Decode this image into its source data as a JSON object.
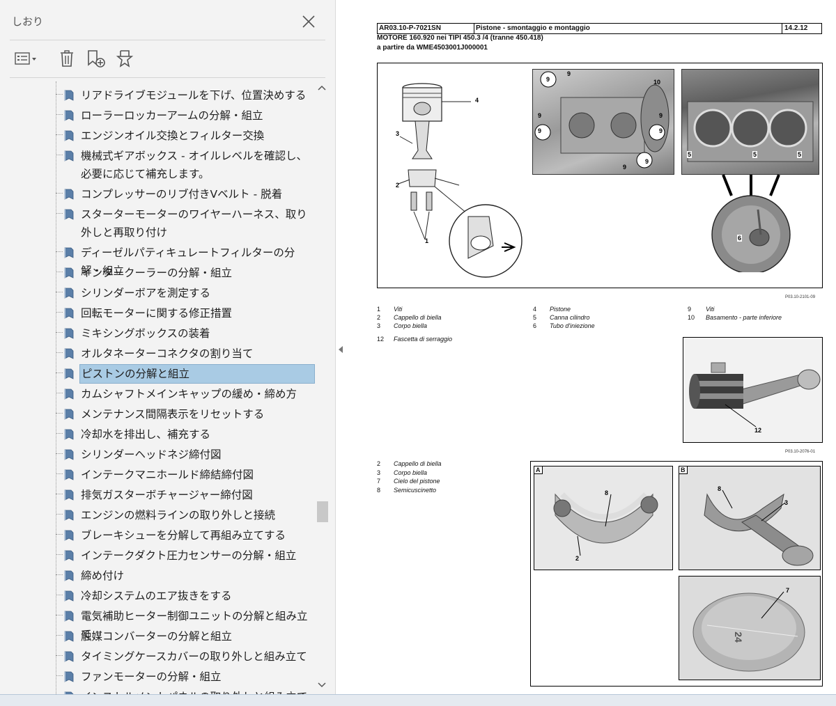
{
  "bookmarks_pane": {
    "title": "しおり",
    "close_icon": "close-icon",
    "toolbar": [
      {
        "name": "options-menu",
        "icon": "list-options-icon"
      },
      {
        "name": "delete",
        "icon": "trash-icon"
      },
      {
        "name": "new-bookmark",
        "icon": "add-bookmark-icon"
      },
      {
        "name": "find-current",
        "icon": "find-bookmark-icon"
      }
    ],
    "items": [
      {
        "label": "リアドライブモジュールを下げ、位置決めする"
      },
      {
        "label": "ローラーロッカーアームの分解・組立"
      },
      {
        "label": "エンジンオイル交換とフィルター交換"
      },
      {
        "label": "機械式ギアボックス - オイルレベルを確認し、必要に応じて補充します。"
      },
      {
        "label": "コンプレッサーのリブ付きVベルト - 脱着"
      },
      {
        "label": "スターターモーターのワイヤーハーネス、取り外しと再取り付け"
      },
      {
        "label": "ディーゼルパティキュレートフィルターの分解・組立"
      },
      {
        "label": "インタークーラーの分解・組立"
      },
      {
        "label": "シリンダーボアを測定する"
      },
      {
        "label": "回転モーターに関する修正措置"
      },
      {
        "label": "ミキシングボックスの装着"
      },
      {
        "label": "オルタネーターコネクタの割り当て"
      },
      {
        "label": "ピストンの分解と組立",
        "selected": true
      },
      {
        "label": "カムシャフトメインキャップの緩め・締め方"
      },
      {
        "label": "メンテナンス間隔表示をリセットする"
      },
      {
        "label": "冷却水を排出し、補充する"
      },
      {
        "label": "シリンダーヘッドネジ締付図"
      },
      {
        "label": "インテークマニホールド締結締付図"
      },
      {
        "label": "排気ガスターボチャージャー締付図"
      },
      {
        "label": "エンジンの燃料ラインの取り外しと接続"
      },
      {
        "label": "ブレーキシューを分解して再組み立てする"
      },
      {
        "label": "インテークダクト圧力センサーの分解・組立"
      },
      {
        "label": "締め付け"
      },
      {
        "label": "冷却システムのエア抜きをする"
      },
      {
        "label": "電気補助ヒーター制御ユニットの分解と組み立て"
      },
      {
        "label": "触媒コンバーターの分解と組立"
      },
      {
        "label": "タイミングケースカバーの取り外しと組み立て"
      },
      {
        "label": "ファンモーターの分解・組立"
      },
      {
        "label": "インストルメントパネルの取り外しと組み立て"
      }
    ],
    "selected_color": "#a9cbe4"
  },
  "document": {
    "header": {
      "code": "AR03.10-P-7021SN",
      "title": "Pistone - smontaggio e montaggio",
      "date": "14.2.12"
    },
    "engine_line": "MOTORE   160.920 nei TIPI 450.3 /4 (tranne 450.418)",
    "serial_line": "a partire da WME4503001J000001",
    "fig1": {
      "ref": "P03.10-2101-09",
      "callouts": [
        "4",
        "3",
        "2",
        "1",
        "9",
        "9",
        "9",
        "9",
        "9",
        "9",
        "9",
        "10",
        "9",
        "5",
        "5",
        "5",
        "6"
      ]
    },
    "legend1": [
      {
        "num": "1",
        "text": "Viti"
      },
      {
        "num": "2",
        "text": "Cappello di biella"
      },
      {
        "num": "3",
        "text": "Corpo biella"
      },
      {
        "num": "4",
        "text": "Pistone"
      },
      {
        "num": "5",
        "text": "Canna cilindro"
      },
      {
        "num": "6",
        "text": "Tubo d'iniezione"
      },
      {
        "num": "9",
        "text": "Viti"
      },
      {
        "num": "10",
        "text": "Basamento - parte inferiore"
      },
      {
        "num": "12",
        "text": "Fascetta di serraggio"
      }
    ],
    "fig2": {
      "ref": "P03.10-2076-01",
      "callout": "12"
    },
    "legend2": [
      {
        "num": "2",
        "text": "Cappello di biella"
      },
      {
        "num": "3",
        "text": "Corpo biella"
      },
      {
        "num": "7",
        "text": "Cielo del pistone"
      },
      {
        "num": "8",
        "text": "Semicuscinetto"
      }
    ],
    "fig3": {
      "panel_a": "A",
      "panel_b": "B",
      "callout_a1": "8",
      "callout_a2": "2",
      "callout_b1": "8",
      "callout_b2": "3",
      "callout_c": "7",
      "piston_stamp": "24"
    }
  }
}
